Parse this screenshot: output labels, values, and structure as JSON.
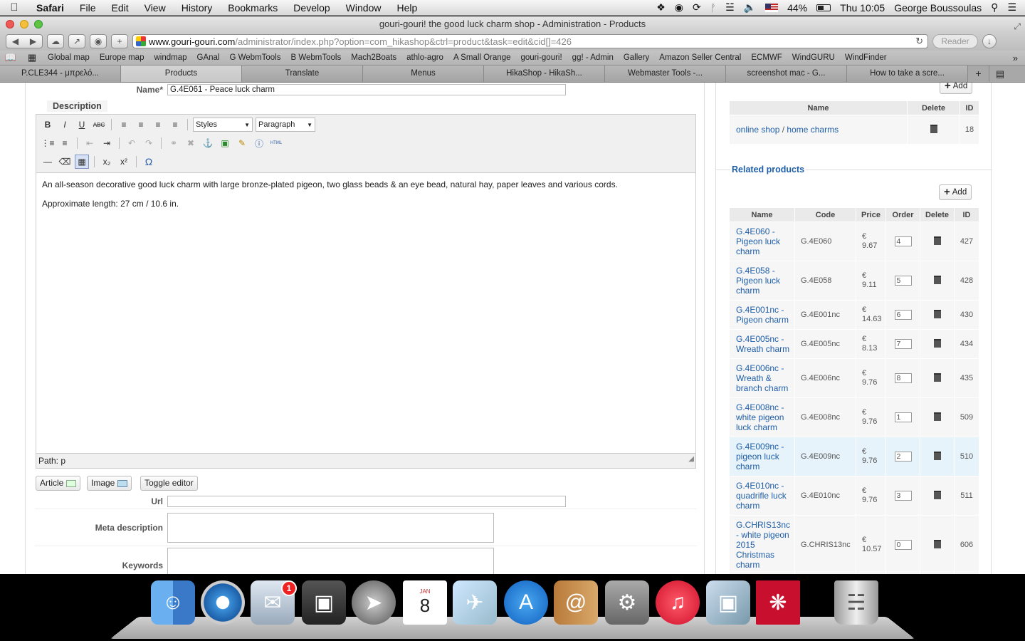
{
  "menubar": {
    "apple": "",
    "app": "Safari",
    "items": [
      "File",
      "Edit",
      "View",
      "History",
      "Bookmarks",
      "Develop",
      "Window",
      "Help"
    ],
    "battery": "44%",
    "clock": "Thu 10:05",
    "user": "George Boussoulas"
  },
  "window": {
    "title": "gouri-gouri! the good luck charm shop - Administration - Products"
  },
  "toolbar": {
    "url_host": "www.gouri-gouri.com",
    "url_path": "/administrator/index.php?option=com_hikashop&ctrl=product&task=edit&cid[]=426",
    "reader": "Reader"
  },
  "bookmarks": [
    "Global map",
    "Europe map",
    "windmap",
    "GAnal",
    "G WebmTools",
    "B WebmTools",
    "Mach2Boats",
    "athlo-agro",
    "A Small Orange",
    "gouri-gouri!",
    "gg! - Admin",
    "Gallery",
    "Amazon Seller Central",
    "ECMWF",
    "WindGURU",
    "WindFinder"
  ],
  "tabs": [
    "P.CLE344 - μπρελό...",
    "Products",
    "Translate",
    "Menus",
    "HikaShop - HikaSh...",
    "Webmaster Tools -...",
    "screenshot mac - G...",
    "How to take a scre..."
  ],
  "form": {
    "name_label": "Name*",
    "name_value": "G.4E061 - Peace luck charm",
    "description_label": "Description",
    "styles_select": "Styles",
    "format_select": "Paragraph",
    "html_label": "HTML",
    "body_p1": "An all-season decorative good luck charm with large bronze-plated pigeon, two glass beads & an eye bead, natural hay, paper leaves and various cords.",
    "body_p2": "Approximate length:  27 cm / 10.6 in.",
    "path": "Path: p",
    "btn_article": "Article",
    "btn_image": "Image",
    "btn_toggle": "Toggle editor",
    "url_label": "Url",
    "meta_label": "Meta description",
    "keywords_label": "Keywords"
  },
  "categories": {
    "add_label": "Add",
    "headers": [
      "Name",
      "Delete",
      "ID"
    ],
    "row": {
      "path1": "online shop",
      "sep": " / ",
      "path2": "home charms",
      "id": "18"
    }
  },
  "related": {
    "title": "Related products",
    "add_label": "Add",
    "headers": [
      "Name",
      "Code",
      "Price",
      "Order",
      "Delete",
      "ID"
    ],
    "rows": [
      {
        "name": "G.4E060 - Pigeon luck charm",
        "code": "G.4E060",
        "cur": "€",
        "price": "9.67",
        "order": "4",
        "id": "427"
      },
      {
        "name": "G.4E058 - Pigeon luck charm",
        "code": "G.4E058",
        "cur": "€",
        "price": "9.11",
        "order": "5",
        "id": "428"
      },
      {
        "name": "G.4E001nc - Pigeon charm",
        "code": "G.4E001nc",
        "cur": "€",
        "price": "14.63",
        "order": "6",
        "id": "430"
      },
      {
        "name": "G.4E005nc - Wreath charm",
        "code": "G.4E005nc",
        "cur": "€",
        "price": "8.13",
        "order": "7",
        "id": "434"
      },
      {
        "name": "G.4E006nc - Wreath & branch charm",
        "code": "G.4E006nc",
        "cur": "€",
        "price": "9.76",
        "order": "8",
        "id": "435"
      },
      {
        "name": "G.4E008nc - white pigeon luck charm",
        "code": "G.4E008nc",
        "cur": "€",
        "price": "9.76",
        "order": "1",
        "id": "509"
      },
      {
        "name": "G.4E009nc - pigeon luck charm",
        "code": "G.4E009nc",
        "cur": "€",
        "price": "9.76",
        "order": "2",
        "id": "510"
      },
      {
        "name": "G.4E010nc - quadrifle luck charm",
        "code": "G.4E010nc",
        "cur": "€",
        "price": "9.76",
        "order": "3",
        "id": "511"
      },
      {
        "name": "G.CHRIS13nc - white pigeon 2015 Christmas charm",
        "code": "G.CHRIS13nc",
        "cur": "€",
        "price": "10.57",
        "order": "0",
        "id": "606"
      }
    ]
  },
  "dock": {
    "mail_badge": "1",
    "calendar_month": "JAN",
    "calendar_day": "8"
  }
}
